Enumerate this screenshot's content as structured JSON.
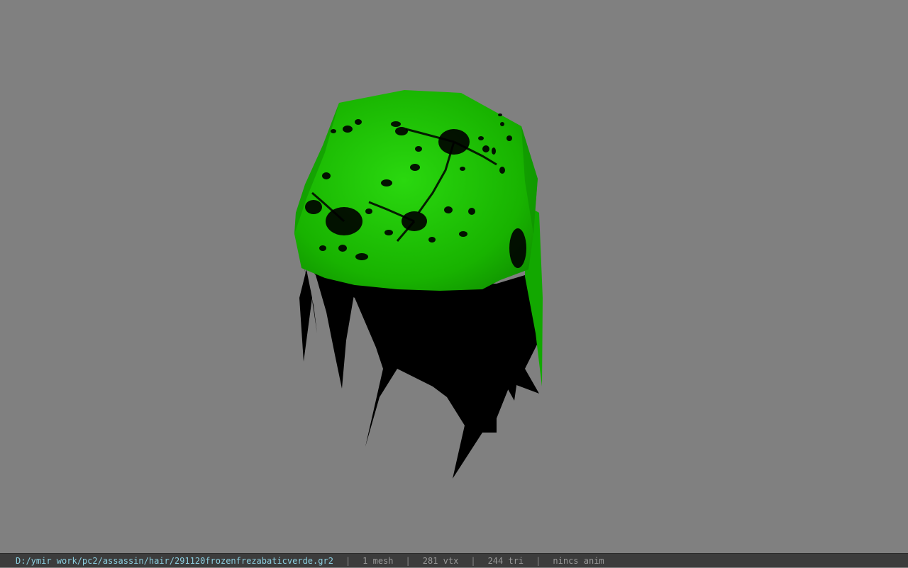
{
  "viewport": {
    "background_color": "#808080",
    "model": {
      "icon": "hair-mesh-model",
      "primary_color": "#17b500",
      "highlight_color": "#2ad80f",
      "shadow_color": "#000000"
    }
  },
  "status": {
    "file_path": "D:/ymir work/pc2/assassin/hair/291120frozenfrezabaticverde.gr2",
    "separator": "|",
    "mesh_count": "1 mesh",
    "vertex_count": "281 vtx",
    "triangle_count": "244 tri",
    "anim_status": "nincs anim"
  }
}
